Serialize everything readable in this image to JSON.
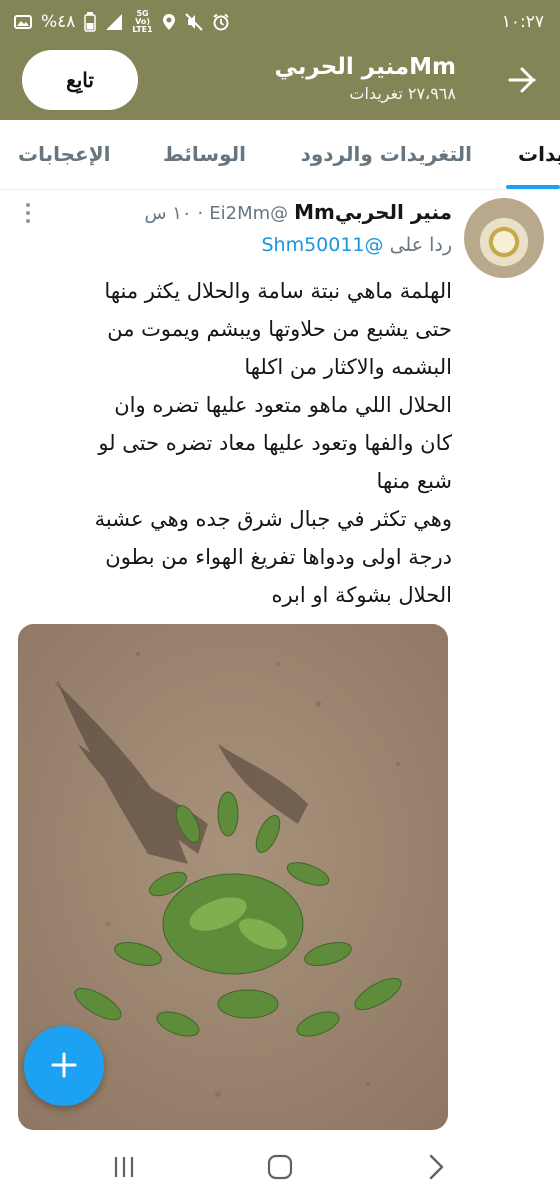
{
  "status_bar": {
    "time": "١٠:٢٧",
    "battery": "%٤٨",
    "network_top": "5G",
    "network_mid": "Vo)",
    "network_bot": "LTE1"
  },
  "header": {
    "name": "منير الحربيMm",
    "tweet_count": "٢٧،٩٦٨ تغريدات",
    "follow_label": "تابِع"
  },
  "tabs": [
    {
      "label": "يدات"
    },
    {
      "label": "التغريدات والردود"
    },
    {
      "label": "الوسائط"
    },
    {
      "label": "الإعجابات"
    }
  ],
  "tweet": {
    "name": "منير الحربيMm",
    "handle": "@Ei2Mm",
    "dot": "·",
    "time": "١٠ س",
    "reply_prefix": "ردا على",
    "reply_to": "@Shm50011",
    "text": "الهلمة ماهي نبتة سامة والحلال يكثر منها\nحتى يشبع من حلاوتها ويبشم ويموت من\nالبشمه والاكثار من اكلها\nالحلال اللي ماهو متعود عليها تضره وان\nكان والفها وتعود عليها معاد تضره حتى لو\nشبع منها\nوهي تكثر في جبال شرق جده وهي عشبة\nدرجة اولى ودواها تفريغ الهواء من بطون\nالحلال بشوكة او ابره"
  },
  "colors": {
    "header_bg": "#838557",
    "accent": "#1da1f2",
    "mention": "#1b95e0"
  },
  "icons": {
    "back": "arrow-right",
    "more": "vertical-dots",
    "fab": "plus",
    "nav_recents": "three-bars",
    "nav_home": "rounded-square",
    "nav_back": "chevron-right"
  }
}
